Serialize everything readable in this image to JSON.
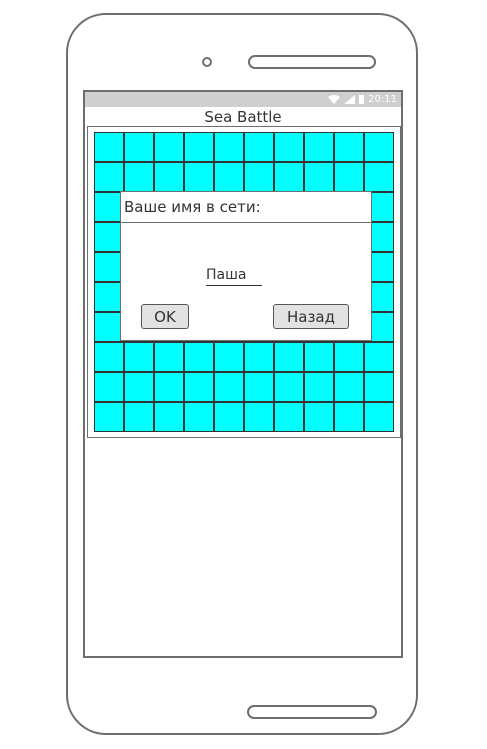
{
  "status_bar": {
    "time": "20:11"
  },
  "app": {
    "title": "Sea Battle"
  },
  "dialog": {
    "title": "Ваше имя в сети:",
    "name_value": "Паша",
    "ok_label": "OK",
    "back_label": "Назад"
  },
  "board": {
    "rows": 10,
    "cols": 10,
    "cell_color": "#00ffff"
  },
  "colors": {
    "status_bar": "#cfcfcf",
    "device_outline": "#6e6e6e"
  }
}
